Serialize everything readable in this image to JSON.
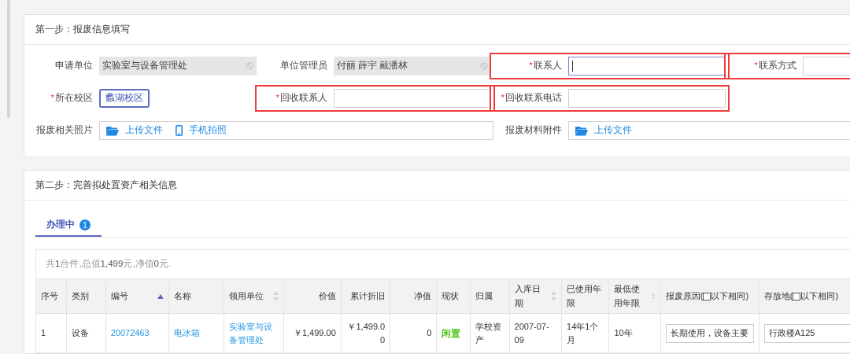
{
  "step1": {
    "title": "第一步：报废信息填写",
    "fields": [
      {
        "kind": "disabled",
        "label": "申请单位",
        "value": "实验室与设备管理处",
        "highlighted": false
      },
      {
        "kind": "disabled",
        "label": "单位管理员",
        "value": "付丽 薛宇 戴潘林",
        "highlighted": false
      },
      {
        "kind": "text",
        "label": "联系人",
        "required_mark": "*",
        "focused": true,
        "highlighted": true
      },
      {
        "kind": "text",
        "label": "联系方式",
        "required_mark": "*",
        "focused": false,
        "highlighted": true
      },
      {
        "kind": "tag",
        "label": "所在校区",
        "required_mark": "*",
        "value": "蠡湖校区",
        "highlighted": false
      },
      {
        "kind": "text",
        "label": "回收联系人",
        "required_mark": "*",
        "focused": false,
        "highlighted": true
      },
      {
        "kind": "text",
        "label": "回收联系电话",
        "required_mark": "*",
        "focused": false,
        "highlighted": true
      },
      {
        "kind": "upload",
        "label": "报废相关照片",
        "highlighted": false,
        "actions": [
          {
            "kind": "folder",
            "label": "上传文件"
          },
          {
            "kind": "phone",
            "label": "手机拍照"
          }
        ]
      },
      {
        "kind": "upload",
        "label": "报废材料附件",
        "highlighted": false,
        "actions": [
          {
            "kind": "folder",
            "label": "上传文件"
          }
        ]
      }
    ]
  },
  "step2": {
    "title": "第二步：完善拟处置资产相关信息",
    "tabs": [
      {
        "label": "办理中",
        "badge": "1",
        "selected": true
      }
    ],
    "summary": "共**1**台件,总值**1,499**元,净值**0**元.",
    "columns": [
      {
        "label": "序号",
        "numeric": false,
        "sortable": false
      },
      {
        "label": "类别",
        "numeric": false,
        "sortable": false
      },
      {
        "label": "编号",
        "numeric": false,
        "sortable": true,
        "sorted": true
      },
      {
        "label": "名称",
        "numeric": false,
        "sortable": false
      },
      {
        "label": "领用单位",
        "numeric": false,
        "sortable": true,
        "sorted": false
      },
      {
        "label": "价值",
        "numeric": true,
        "sortable": false
      },
      {
        "label": "累计折旧",
        "numeric": true,
        "sortable": false
      },
      {
        "label": "净值",
        "numeric": true,
        "sortable": false
      },
      {
        "label": "现状",
        "numeric": false,
        "sortable": false
      },
      {
        "label": "归属",
        "numeric": false,
        "sortable": false
      },
      {
        "label": "入库日期",
        "numeric": false,
        "sortable": true,
        "sorted": false
      },
      {
        "label": "已使用年限",
        "numeric": false,
        "sortable": false
      },
      {
        "label": "最低使用年限",
        "numeric": false,
        "sortable": true,
        "sorted": false
      },
      {
        "label": "报废原因(",
        "suffix": "以下相同)",
        "numeric": false,
        "sortable": false,
        "checked": false
      },
      {
        "label": "存放地(",
        "suffix": "以下相同)",
        "numeric": false,
        "sortable": false,
        "checked": false
      }
    ],
    "rows": [
      [
        {
          "kind": "text",
          "text": "1"
        },
        {
          "kind": "text",
          "text": "设备"
        },
        {
          "kind": "link",
          "text": "20072463"
        },
        {
          "kind": "link",
          "text": "电冰箱"
        },
        {
          "kind": "link",
          "text": "实验室与设备管理处"
        },
        {
          "kind": "money",
          "text": "￥1,499.00"
        },
        {
          "kind": "money",
          "text": "￥1,499.00"
        },
        {
          "kind": "money",
          "text": "0"
        },
        {
          "kind": "status",
          "text": "闲置",
          "color": "#52c41a"
        },
        {
          "kind": "text",
          "text": "学校资产"
        },
        {
          "kind": "text",
          "text": "2007-07-09"
        },
        {
          "kind": "text",
          "text": "14年1个月"
        },
        {
          "kind": "text",
          "text": "10年"
        },
        {
          "kind": "input",
          "text": "长期使用，设备主要"
        },
        {
          "kind": "select",
          "text": "行政楼A125"
        }
      ]
    ]
  }
}
